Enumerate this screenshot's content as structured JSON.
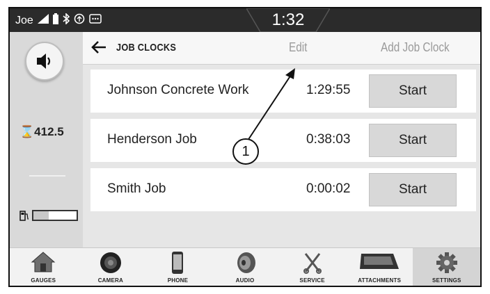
{
  "status_bar": {
    "user": "Joe",
    "time": "1:32",
    "icons": [
      "signal-icon",
      "battery-icon",
      "bluetooth-icon",
      "sync-icon",
      "message-icon"
    ]
  },
  "left_rail": {
    "speaker_icon": "speaker-icon",
    "hours_value": "412.5",
    "hours_icon": "hourglass-icon",
    "fuel_icon": "fuel-pump-icon",
    "fuel_level": 0.35
  },
  "header": {
    "title": "JOB CLOCKS",
    "edit_label": "Edit",
    "add_label": "Add Job Clock"
  },
  "job_clocks": [
    {
      "name": "Johnson Concrete Work",
      "time": "1:29:55",
      "button": "Start"
    },
    {
      "name": "Henderson Job",
      "time": "0:38:03",
      "button": "Start"
    },
    {
      "name": "Smith Job",
      "time": "0:00:02",
      "button": "Start"
    }
  ],
  "nav": [
    {
      "label": "GAUGES",
      "icon": "house-icon"
    },
    {
      "label": "CAMERA",
      "icon": "camera-icon"
    },
    {
      "label": "PHONE",
      "icon": "phone-icon"
    },
    {
      "label": "AUDIO",
      "icon": "audio-speaker-icon"
    },
    {
      "label": "SERVICE",
      "icon": "wrench-screwdriver-icon"
    },
    {
      "label": "ATTACHMENTS",
      "icon": "bucket-icon"
    },
    {
      "label": "SETTINGS",
      "icon": "gear-icon",
      "active": true
    }
  ],
  "callout": {
    "number": "1"
  }
}
